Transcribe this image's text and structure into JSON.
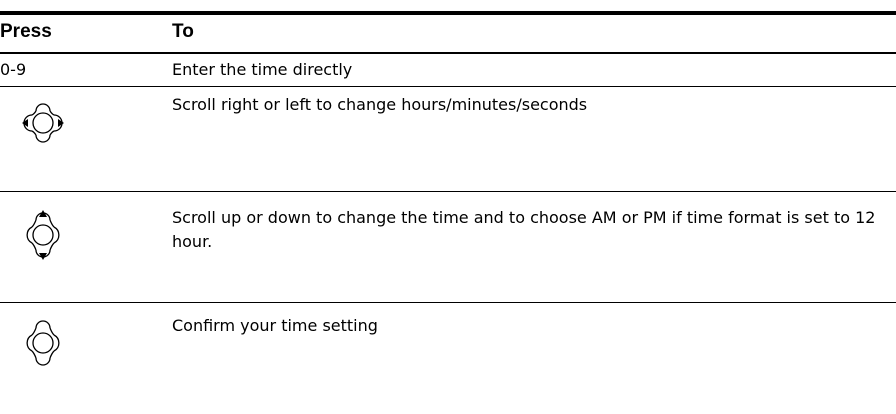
{
  "table": {
    "headers": {
      "press": "Press",
      "to": "To"
    },
    "rows": [
      {
        "press": "0-9",
        "to": "Enter the time directly"
      },
      {
        "press_icon": "nav-pad-left-right-icon",
        "to": "Scroll right or left to change hours/minutes/seconds"
      },
      {
        "press_icon": "nav-pad-up-down-icon",
        "to": "Scroll up or down to change the time and to choose AM or PM if time format is set to 12 hour."
      },
      {
        "press_icon": "nav-pad-center-icon",
        "to": "Confirm your time setting"
      }
    ]
  }
}
